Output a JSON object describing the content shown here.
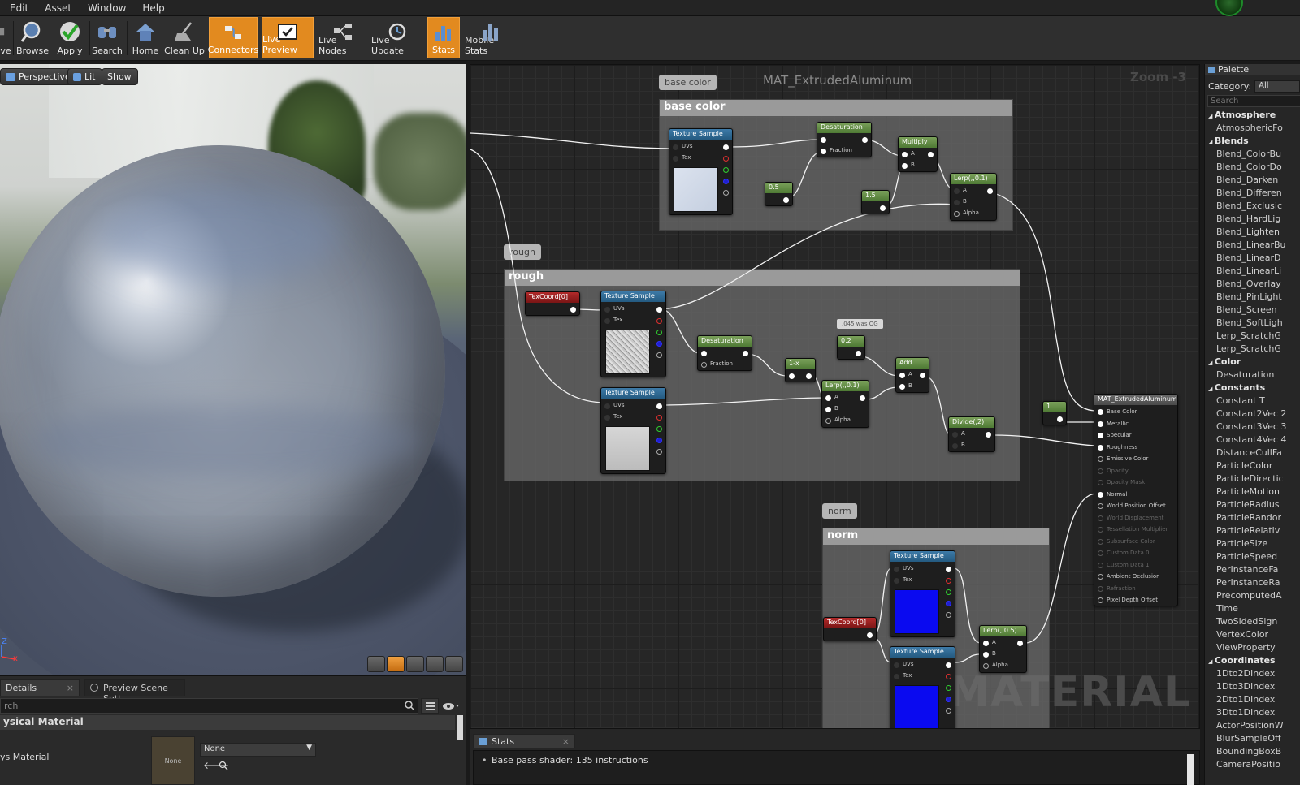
{
  "menu": [
    "Edit",
    "Asset",
    "Window",
    "Help"
  ],
  "toolbar": [
    {
      "label": "ve",
      "icon": "save-icon",
      "active": false
    },
    {
      "label": "Browse",
      "icon": "magnifier-icon",
      "active": false
    },
    {
      "label": "Apply",
      "icon": "checkmark-icon",
      "active": false
    },
    {
      "label": "Search",
      "icon": "binoculars-icon",
      "active": false
    },
    {
      "label": "Home",
      "icon": "home-icon",
      "active": false
    },
    {
      "label": "Clean Up",
      "icon": "broom-icon",
      "active": false
    },
    {
      "label": "Connectors",
      "icon": "connectors-icon",
      "active": true
    },
    {
      "label": "Live Preview",
      "icon": "live-preview-icon",
      "active": true
    },
    {
      "label": "Live Nodes",
      "icon": "live-nodes-icon",
      "active": false
    },
    {
      "label": "Live Update",
      "icon": "live-update-icon",
      "active": false
    },
    {
      "label": "Stats",
      "icon": "stats-icon",
      "active": true
    },
    {
      "label": "Mobile Stats",
      "icon": "mobile-stats-icon",
      "active": false
    }
  ],
  "viewport": {
    "buttons": [
      "Perspective",
      "Lit",
      "Show"
    ],
    "axis_z": "Z",
    "axis_x": "x"
  },
  "details": {
    "tab_details": "Details",
    "tab_preview": "Preview Scene Sett",
    "search_placeholder": "rch",
    "section": "ysical Material",
    "row_label": "ys Material",
    "thumb_text": "None",
    "combo_value": "None"
  },
  "graph": {
    "title": "MAT_ExtrudedAluminum",
    "zoom": "Zoom -3",
    "watermark": "MATERIAL",
    "bubbles": {
      "base": "base color",
      "rough": "rough",
      "norm": "norm"
    },
    "comments": {
      "base": "base color",
      "rough": "rough",
      "norm": "norm"
    },
    "note": ".045 was OG",
    "nodes": {
      "tex1": "Texture Sample",
      "tex2": "Texture Sample",
      "tex3": "Texture Sample",
      "tex4": "Texture Sample",
      "tex5": "Texture Sample",
      "desat1": "Desaturation",
      "desat2": "Desaturation",
      "multiply": "Multiply",
      "lerp1": "Lerp(,,0.1)",
      "lerp2": "Lerp(,,0.1)",
      "lerp3": "Lerp(,,0.5)",
      "c05": "0.5",
      "c15": "1.5",
      "c02": "0.2",
      "c1": "1",
      "oneminus": "1-x",
      "add": "Add",
      "divide": "Divide(,2)",
      "texcoord1": "TexCoord[0]",
      "texcoord2": "TexCoord[0]",
      "result": "MAT_ExtrudedAluminum"
    },
    "pins": {
      "uvs": "UVs",
      "tex": "Tex",
      "fraction": "Fraction",
      "a": "A",
      "b": "B",
      "alpha": "Alpha"
    },
    "result_pins": [
      {
        "label": "Base Color",
        "enabled": true
      },
      {
        "label": "Metallic",
        "enabled": true
      },
      {
        "label": "Specular",
        "enabled": true
      },
      {
        "label": "Roughness",
        "enabled": true
      },
      {
        "label": "Emissive Color",
        "enabled": true
      },
      {
        "label": "Opacity",
        "enabled": false
      },
      {
        "label": "Opacity Mask",
        "enabled": false
      },
      {
        "label": "Normal",
        "enabled": true
      },
      {
        "label": "World Position Offset",
        "enabled": true
      },
      {
        "label": "World Displacement",
        "enabled": false
      },
      {
        "label": "Tessellation Multiplier",
        "enabled": false
      },
      {
        "label": "Subsurface Color",
        "enabled": false
      },
      {
        "label": "Custom Data 0",
        "enabled": false
      },
      {
        "label": "Custom Data 1",
        "enabled": false
      },
      {
        "label": "Ambient Occlusion",
        "enabled": true
      },
      {
        "label": "Refraction",
        "enabled": false
      },
      {
        "label": "Pixel Depth Offset",
        "enabled": true
      }
    ]
  },
  "palette": {
    "title": "Palette",
    "category_label": "Category:",
    "category_value": "All",
    "search_placeholder": "Search",
    "items": [
      {
        "label": "Atmosphere",
        "cat": true
      },
      {
        "label": "AtmosphericFo",
        "cat": false
      },
      {
        "label": "Blends",
        "cat": true
      },
      {
        "label": "Blend_ColorBu",
        "cat": false
      },
      {
        "label": "Blend_ColorDo",
        "cat": false
      },
      {
        "label": "Blend_Darken",
        "cat": false
      },
      {
        "label": "Blend_Differen",
        "cat": false
      },
      {
        "label": "Blend_Exclusic",
        "cat": false
      },
      {
        "label": "Blend_HardLig",
        "cat": false
      },
      {
        "label": "Blend_Lighten",
        "cat": false
      },
      {
        "label": "Blend_LinearBu",
        "cat": false
      },
      {
        "label": "Blend_LinearD",
        "cat": false
      },
      {
        "label": "Blend_LinearLi",
        "cat": false
      },
      {
        "label": "Blend_Overlay",
        "cat": false
      },
      {
        "label": "Blend_PinLight",
        "cat": false
      },
      {
        "label": "Blend_Screen",
        "cat": false
      },
      {
        "label": "Blend_SoftLigh",
        "cat": false
      },
      {
        "label": "Lerp_ScratchG",
        "cat": false
      },
      {
        "label": "Lerp_ScratchG",
        "cat": false
      },
      {
        "label": "Color",
        "cat": true
      },
      {
        "label": "Desaturation",
        "cat": false
      },
      {
        "label": "Constants",
        "cat": true
      },
      {
        "label": "Constant          T",
        "cat": false
      },
      {
        "label": "Constant2Vec 2",
        "cat": false
      },
      {
        "label": "Constant3Vec 3",
        "cat": false
      },
      {
        "label": "Constant4Vec 4",
        "cat": false
      },
      {
        "label": "DistanceCullFa",
        "cat": false
      },
      {
        "label": "ParticleColor",
        "cat": false
      },
      {
        "label": "ParticleDirectic",
        "cat": false
      },
      {
        "label": "ParticleMotion",
        "cat": false
      },
      {
        "label": "ParticleRadius",
        "cat": false
      },
      {
        "label": "ParticleRandor",
        "cat": false
      },
      {
        "label": "ParticleRelativ",
        "cat": false
      },
      {
        "label": "ParticleSize",
        "cat": false
      },
      {
        "label": "ParticleSpeed",
        "cat": false
      },
      {
        "label": "PerInstanceFa",
        "cat": false
      },
      {
        "label": "PerInstanceRa",
        "cat": false
      },
      {
        "label": "PrecomputedA",
        "cat": false
      },
      {
        "label": "Time",
        "cat": false
      },
      {
        "label": "TwoSidedSign",
        "cat": false
      },
      {
        "label": "VertexColor",
        "cat": false
      },
      {
        "label": "ViewProperty",
        "cat": false
      },
      {
        "label": "Coordinates",
        "cat": true
      },
      {
        "label": "1Dto2DIndex",
        "cat": false
      },
      {
        "label": "1Dto3DIndex",
        "cat": false
      },
      {
        "label": "2Dto1DIndex",
        "cat": false
      },
      {
        "label": "3Dto1DIndex",
        "cat": false
      },
      {
        "label": "ActorPositionW",
        "cat": false
      },
      {
        "label": "BlurSampleOff",
        "cat": false
      },
      {
        "label": "BoundingBoxB",
        "cat": false
      },
      {
        "label": "CameraPositio",
        "cat": false
      }
    ]
  },
  "stats": {
    "tab": "Stats",
    "line": "Base pass shader: 135 instructions"
  }
}
